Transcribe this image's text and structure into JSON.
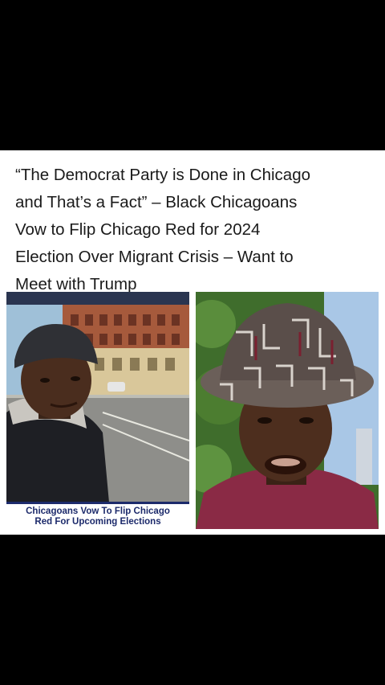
{
  "post": {
    "headline": "“The Democrat Party is Done in Chicago\nand That’s a Fact” – Black Chicagoans\nVow to Flip Chicago Red for 2024\nElection Over Migrant Crisis – Want to\nMeet with Trump"
  },
  "left_photo": {
    "caption": "Chicagoans Vow To Flip Chicago\nRed For Upcoming Elections"
  }
}
